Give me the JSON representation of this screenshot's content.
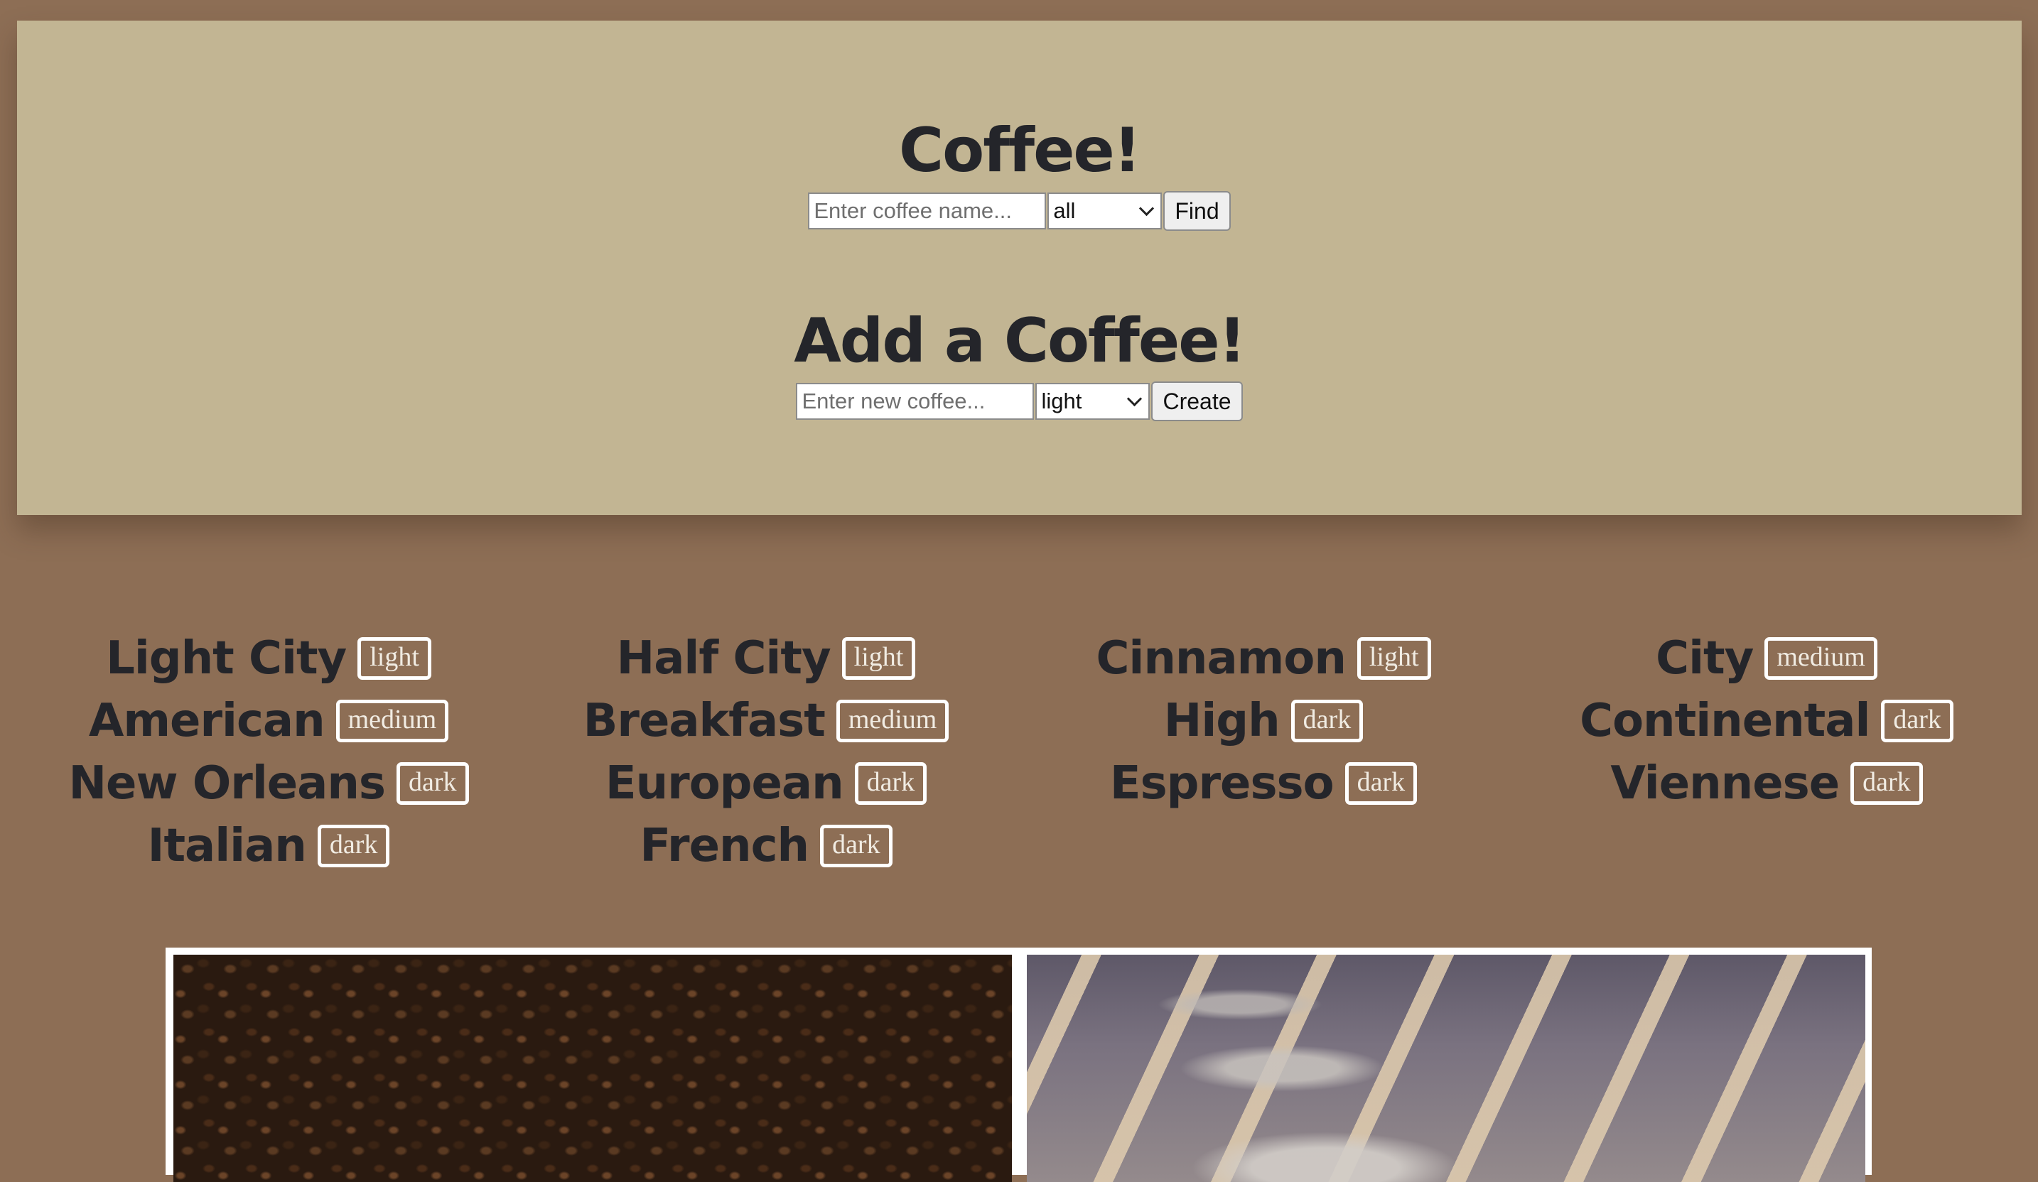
{
  "find_section": {
    "title": "Coffee!",
    "search_placeholder": "Enter coffee name...",
    "roast_filter": "all",
    "button_label": "Find"
  },
  "add_section": {
    "title": "Add a Coffee!",
    "name_placeholder": "Enter new coffee...",
    "roast_select": "light",
    "button_label": "Create"
  },
  "coffees": {
    "columns": [
      [
        {
          "name": "Light City",
          "roast": "light"
        },
        {
          "name": "American",
          "roast": "medium"
        },
        {
          "name": "New Orleans",
          "roast": "dark"
        },
        {
          "name": "Italian",
          "roast": "dark"
        }
      ],
      [
        {
          "name": "Half City",
          "roast": "light"
        },
        {
          "name": "Breakfast",
          "roast": "medium"
        },
        {
          "name": "European",
          "roast": "dark"
        },
        {
          "name": "French",
          "roast": "dark"
        }
      ],
      [
        {
          "name": "Cinnamon",
          "roast": "light"
        },
        {
          "name": "High",
          "roast": "dark"
        },
        {
          "name": "Espresso",
          "roast": "dark"
        }
      ],
      [
        {
          "name": "City",
          "roast": "medium"
        },
        {
          "name": "Continental",
          "roast": "dark"
        },
        {
          "name": "Viennese",
          "roast": "dark"
        }
      ]
    ]
  },
  "colors": {
    "page_background": "#8d6e55",
    "header_background": "#c2b593",
    "heading_text": "#24252a",
    "badge_border": "#ffffff"
  },
  "images": [
    "coffee-beans-photo",
    "cafe-chairs-photo"
  ]
}
